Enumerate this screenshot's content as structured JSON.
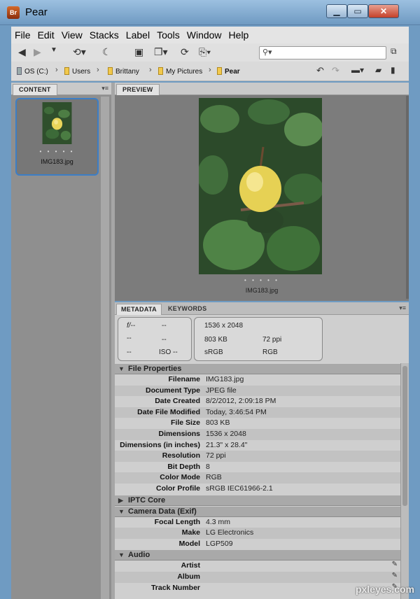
{
  "window": {
    "title": "Pear",
    "app_icon": "Br"
  },
  "menu": [
    "File",
    "Edit",
    "View",
    "Stacks",
    "Label",
    "Tools",
    "Window",
    "Help"
  ],
  "search": {
    "placeholder": ""
  },
  "path": [
    "OS (C:)",
    "Users",
    "Brittany",
    "My Pictures",
    "Pear"
  ],
  "content_panel": {
    "tab": "CONTENT",
    "thumb_name": "IMG183.jpg",
    "stars": "• • • • •"
  },
  "preview_panel": {
    "tab": "PREVIEW",
    "file_name": "IMG183.jpg",
    "stars": "• • • • •"
  },
  "meta_tabs": {
    "metadata": "METADATA",
    "keywords": "KEYWORDS"
  },
  "summary": {
    "aperture": "f/--",
    "shutter": "--",
    "wb": "--",
    "exp": "--",
    "meter": "--",
    "iso": "ISO --",
    "dimensions": "1536 x 2048",
    "size": "803 KB",
    "resolution": "72 ppi",
    "profile": "sRGB",
    "mode": "RGB"
  },
  "sections": {
    "file_props": "File Properties",
    "iptc": "IPTC Core",
    "camera": "Camera Data (Exif)",
    "audio": "Audio"
  },
  "file_properties": [
    {
      "label": "Filename",
      "value": "IMG183.jpg"
    },
    {
      "label": "Document Type",
      "value": "JPEG file"
    },
    {
      "label": "Date Created",
      "value": "8/2/2012, 2:09:18 PM"
    },
    {
      "label": "Date File Modified",
      "value": "Today, 3:46:54 PM"
    },
    {
      "label": "File Size",
      "value": "803 KB"
    },
    {
      "label": "Dimensions",
      "value": "1536 x 2048"
    },
    {
      "label": "Dimensions (in inches)",
      "value": "21.3\" x 28.4\""
    },
    {
      "label": "Resolution",
      "value": "72 ppi"
    },
    {
      "label": "Bit Depth",
      "value": "8"
    },
    {
      "label": "Color Mode",
      "value": "RGB"
    },
    {
      "label": "Color Profile",
      "value": "sRGB IEC61966-2.1"
    }
  ],
  "camera_data": [
    {
      "label": "Focal Length",
      "value": "4.3 mm"
    },
    {
      "label": "Make",
      "value": "LG Electronics"
    },
    {
      "label": "Model",
      "value": "LGP509"
    }
  ],
  "audio": [
    {
      "label": "Artist",
      "value": ""
    },
    {
      "label": "Album",
      "value": ""
    },
    {
      "label": "Track Number",
      "value": ""
    }
  ],
  "watermark": "pxleyes.com"
}
